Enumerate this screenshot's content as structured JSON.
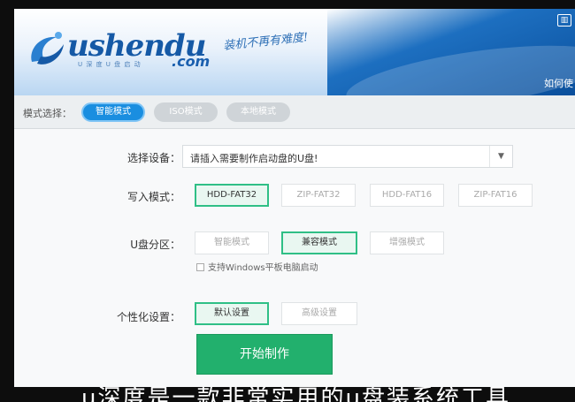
{
  "header": {
    "logo_text": "ushendu",
    "logo_subtext": "U 深 度 U 盘 启 动",
    "logo_domain": ".com",
    "slogan": "装机不再有难度!",
    "help_link": "如何使"
  },
  "mode_bar": {
    "label": "模式选择：",
    "tabs": [
      {
        "label": "智能模式",
        "active": true
      },
      {
        "label": "ISO模式",
        "active": false
      },
      {
        "label": "本地模式",
        "active": false
      }
    ]
  },
  "device": {
    "label": "选择设备：",
    "value": "请插入需要制作启动盘的U盘!"
  },
  "write_mode": {
    "label": "写入模式：",
    "options": [
      "HDD-FAT32",
      "ZIP-FAT32",
      "HDD-FAT16",
      "ZIP-FAT16"
    ],
    "selected": "HDD-FAT32"
  },
  "partition": {
    "label": "U盘分区：",
    "options": [
      "智能模式",
      "兼容模式",
      "增强模式"
    ],
    "selected": "兼容模式"
  },
  "windows_tablet": {
    "label": "支持Windows平板电脑启动",
    "checked": false
  },
  "personalize": {
    "label": "个性化设置：",
    "options": [
      "默认设置",
      "高级设置"
    ],
    "selected": "默认设置"
  },
  "start_button": "开始制作",
  "subtitle": "u深度是一款非常实用的u盘装系统工具",
  "colors": {
    "accent_blue": "#1a8ee0",
    "accent_green": "#22b06d",
    "header_blue": "#1559a6"
  }
}
